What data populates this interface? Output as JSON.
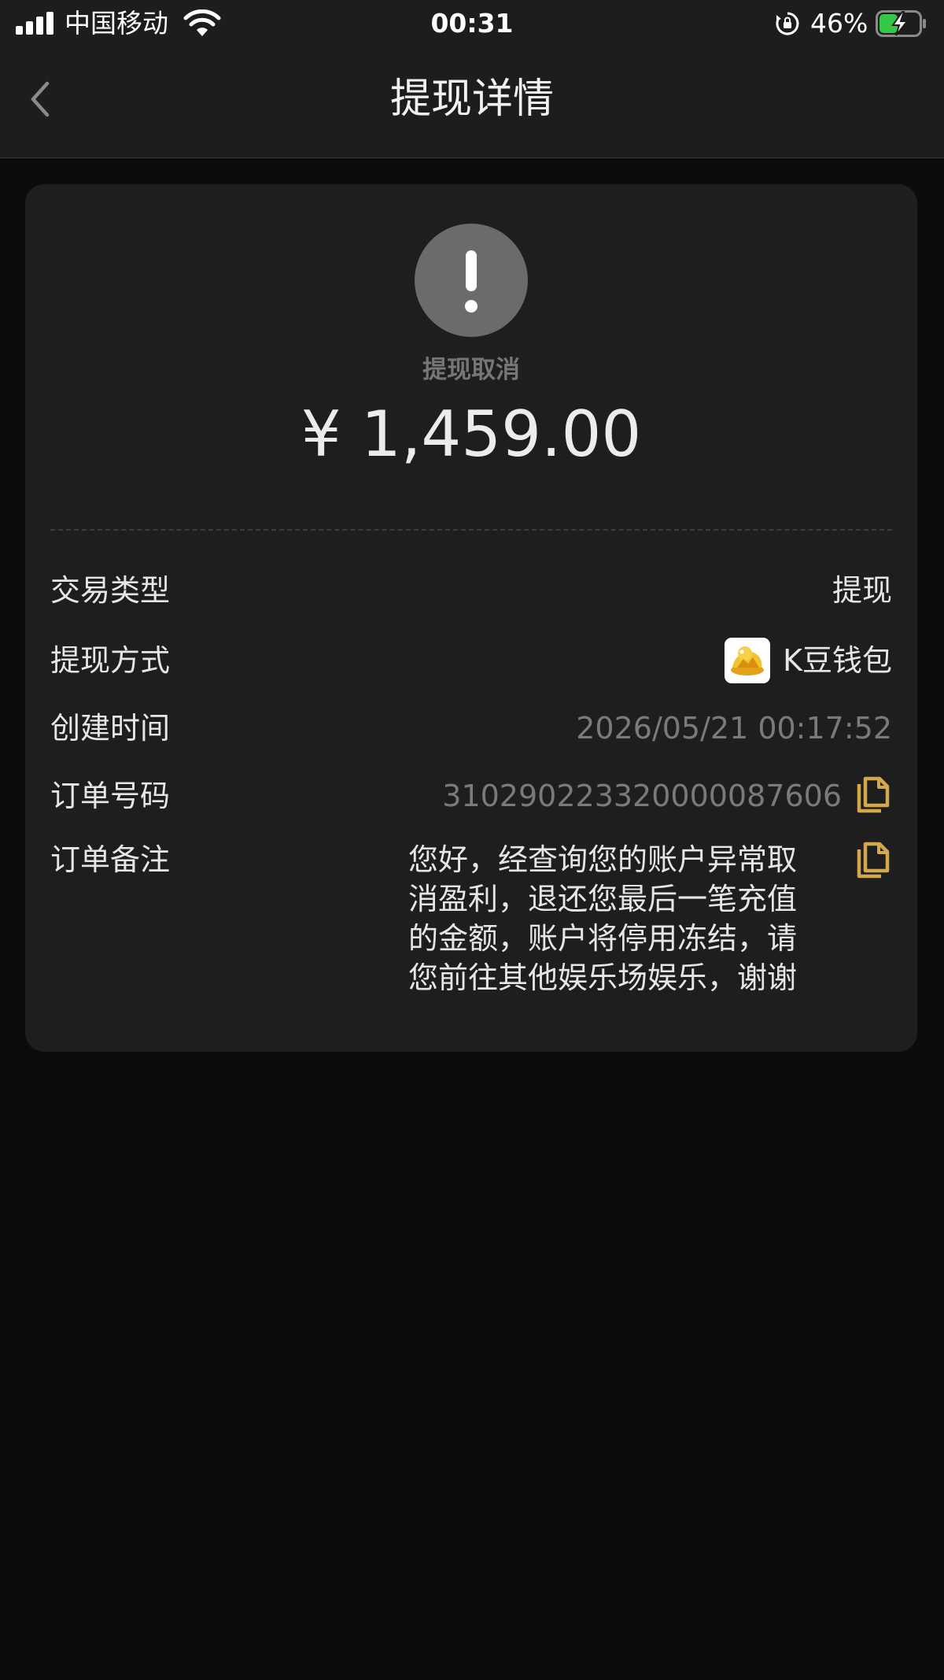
{
  "status_bar": {
    "carrier": "中国移动",
    "time": "00:31",
    "battery_percent": "46%",
    "battery_level": 0.46,
    "battery_charging": true
  },
  "nav": {
    "title": "提现详情",
    "back_icon": "chevron-left-icon"
  },
  "summary": {
    "status_icon": "exclamation-icon",
    "status_text": "提现取消",
    "amount": "¥ 1,459.00"
  },
  "details": {
    "type_label": "交易类型",
    "type_value": "提现",
    "method_label": "提现方式",
    "method_value": "K豆钱包",
    "method_logo": "k-wallet-logo",
    "created_label": "创建时间",
    "created_value": "2026/05/21 00:17:52",
    "order_label": "订单号码",
    "order_value": "310290223320000087606",
    "remark_label": "订单备注",
    "remark_lines": [
      "您好，经查询您的账户异常取",
      "消盈利，退还您最后一笔充值",
      "的金额，账户将停用冻结，请",
      "您前往其他娱乐场娱乐，谢谢"
    ]
  },
  "colors": {
    "background": "#0b0b0b",
    "bar_background": "#1d1d1d",
    "card_background": "#1e1e1e",
    "accent_gold": "#d4a94e",
    "status_circle": "#6b6b6b",
    "muted_text": "#7a7a7a",
    "battery_green": "#33c748"
  }
}
